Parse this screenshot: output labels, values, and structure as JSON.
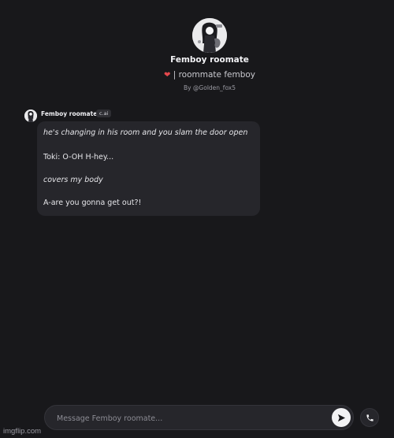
{
  "character": {
    "name": "Femboy roomate",
    "tagline": "| roommate femboy",
    "creator": "By @Golden_fox5"
  },
  "message": {
    "author": "Femboy roomate",
    "badge": "c.ai",
    "lines": [
      "he's changing in his room and you slam the door open",
      "Toki: O-OH H-hey...",
      "covers my body",
      "A-are you gonna get out?!"
    ]
  },
  "composer": {
    "placeholder": "Message Femboy roomate...",
    "value": ""
  },
  "icons": {
    "tagline_emoji": "heart-icon",
    "send": "send-arrow-icon",
    "call": "phone-icon"
  },
  "watermark": "imgflip.com",
  "colors": {
    "background": "#18181b",
    "bubble": "#26262b",
    "heart": "#e5484d"
  }
}
